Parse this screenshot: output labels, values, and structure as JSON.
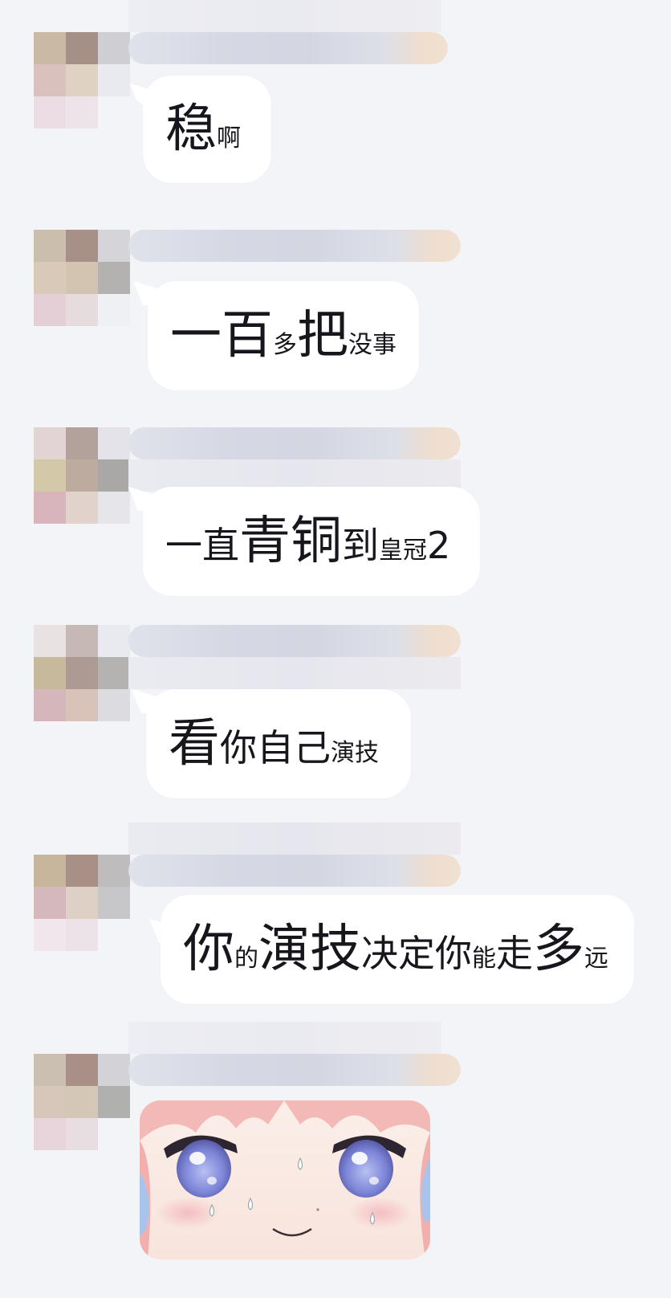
{
  "messages": [
    {
      "id": "msg-1",
      "segments": [
        {
          "text": "稳",
          "size": "big"
        },
        {
          "text": "啊",
          "size": "sm"
        }
      ]
    },
    {
      "id": "msg-2",
      "segments": [
        {
          "text": "一百",
          "size": "big"
        },
        {
          "text": "多",
          "size": "sm"
        },
        {
          "text": "把",
          "size": "big"
        },
        {
          "text": "没事",
          "size": "sm"
        }
      ]
    },
    {
      "id": "msg-3",
      "segments": [
        {
          "text": "一直",
          "size": "mid"
        },
        {
          "text": "青铜",
          "size": "big"
        },
        {
          "text": "到",
          "size": "mid"
        },
        {
          "text": "皇冠",
          "size": "sm"
        },
        {
          "text": "2",
          "size": "mid"
        }
      ]
    },
    {
      "id": "msg-4",
      "segments": [
        {
          "text": "看",
          "size": "big"
        },
        {
          "text": "你自己",
          "size": "mid"
        },
        {
          "text": "演技",
          "size": "sm"
        }
      ]
    },
    {
      "id": "msg-5",
      "segments": [
        {
          "text": "你",
          "size": "big"
        },
        {
          "text": "的",
          "size": "sm"
        },
        {
          "text": "演技",
          "size": "big"
        },
        {
          "text": "决定你",
          "size": "mid"
        },
        {
          "text": "能",
          "size": "sm"
        },
        {
          "text": "走",
          "size": "mid"
        },
        {
          "text": "多",
          "size": "big"
        },
        {
          "text": "远",
          "size": "sm"
        }
      ]
    }
  ],
  "sticker": {
    "icon": "anime-girl-sweat-sticker"
  },
  "colors": {
    "background": "#f3f4f8",
    "bubble": "#ffffff",
    "text": "#16161d"
  }
}
